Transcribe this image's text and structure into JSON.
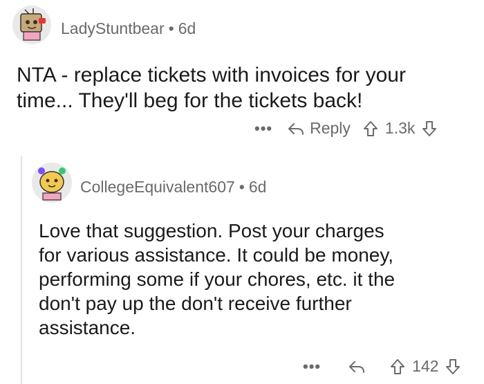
{
  "comments": [
    {
      "username": "LadyStuntbear",
      "separator": "•",
      "age": "6d",
      "text_lines": [
        "NTA - replace tickets with invoices for your",
        "time... They'll beg for the tickets back!"
      ],
      "more": "•••",
      "reply_label": "Reply",
      "score": "1.3k",
      "icons": [
        "avatar-icon",
        "reply-icon",
        "upvote-icon",
        "downvote-icon"
      ]
    },
    {
      "username": "CollegeEquivalent607",
      "separator": "•",
      "age": "6d",
      "text_lines": [
        "Love that suggestion. Post your charges",
        "for various assistance. It could be money,",
        "performing some if your chores, etc. it the",
        "don't pay up the don't receive further",
        "assistance."
      ],
      "more": "•••",
      "score": "142",
      "icons": [
        "avatar-icon",
        "reply-icon",
        "upvote-icon",
        "downvote-icon"
      ]
    }
  ],
  "colors": {
    "text": "#1a1a1b",
    "meta": "#6a6a6a",
    "thread_line": "#e4e4e4"
  }
}
